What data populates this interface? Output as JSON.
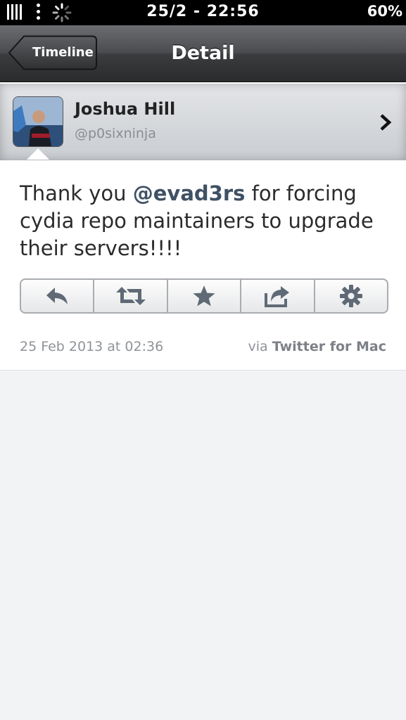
{
  "status_bar": {
    "time": "25/2 - 22:56",
    "battery": "60%",
    "icons": [
      "signal-bars-icon",
      "menu-dots-icon",
      "loading-spinner-icon"
    ]
  },
  "nav": {
    "back_label": "Timeline",
    "title": "Detail"
  },
  "profile": {
    "name": "Joshua Hill",
    "handle": "@p0sixninja",
    "avatar_icon": "avatar-photo",
    "chevron_icon": "chevron-right-icon"
  },
  "tweet": {
    "text_before": "Thank you ",
    "mention": "@evad3rs",
    "text_after": " for forcing cydia repo maintainers to upgrade their servers!!!!",
    "date": "25 Feb 2013 at 02:36",
    "via_prefix": "via ",
    "via_client": "Twitter for Mac"
  },
  "actions": [
    {
      "name": "reply",
      "icon": "reply-icon"
    },
    {
      "name": "retweet",
      "icon": "retweet-icon"
    },
    {
      "name": "favorite",
      "icon": "star-icon"
    },
    {
      "name": "share",
      "icon": "share-icon"
    },
    {
      "name": "settings",
      "icon": "gear-icon"
    }
  ],
  "colors": {
    "accent_mention": "#3f5164",
    "icon_gray": "#5f6a76",
    "background": "#f2f3f5"
  }
}
